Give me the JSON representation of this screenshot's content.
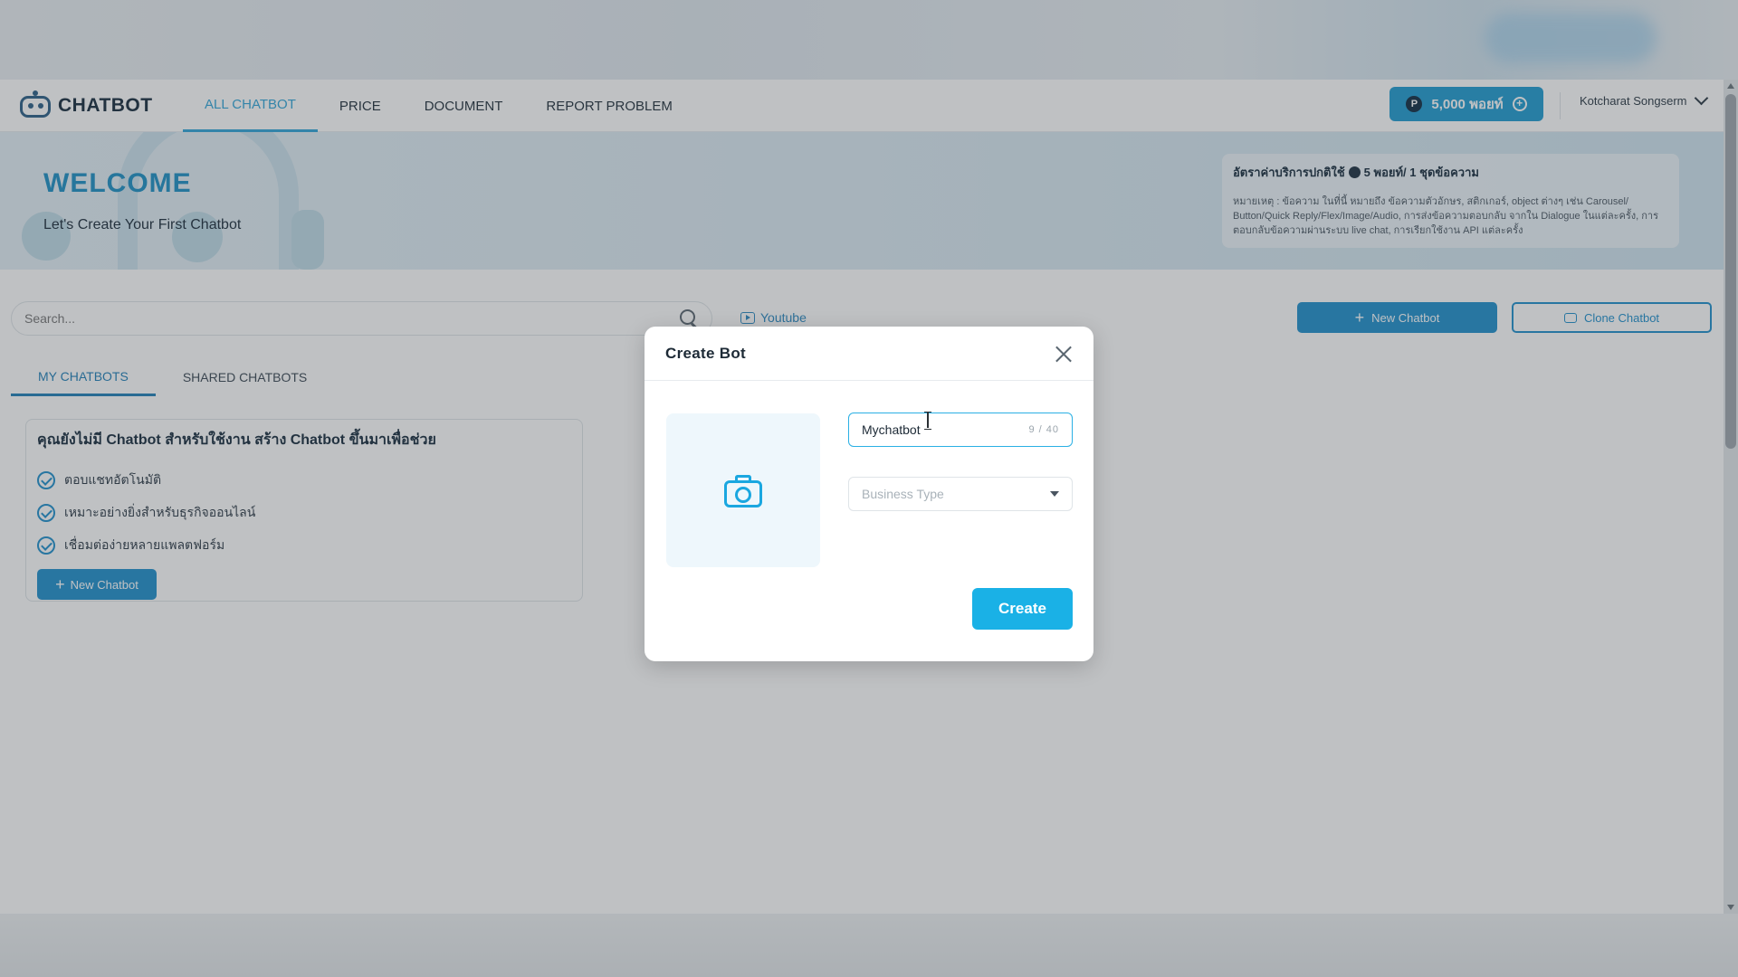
{
  "navbar": {
    "logo_text": "CHATBOT",
    "links": [
      "ALL CHATBOT",
      "PRICE",
      "DOCUMENT",
      "REPORT PROBLEM"
    ],
    "active_link": "ALL CHATBOT",
    "points_label": "5,000 พอยท์",
    "user_name": "Kotcharat Songserm"
  },
  "banner": {
    "welcome": "WELCOME",
    "subtitle": "Let's Create Your First Chatbot",
    "rate_title": "อัตราค่าบริการปกติใช้",
    "rate_value": "5 พอยท์/ 1 ชุดข้อความ",
    "rate_note": "หมายเหตุ : ข้อความ ในที่นี้ หมายถึง ข้อความตัวอักษร, สติกเกอร์, object ต่างๆ เช่น Carousel/ Button/Quick Reply/Flex/Image/Audio, การส่งข้อความตอบกลับ จากใน Dialogue ในแต่ละครั้ง, การตอบกลับข้อความผ่านระบบ live chat, การเรียกใช้งาน API แต่ละครั้ง"
  },
  "toolbar": {
    "search_placeholder": "Search...",
    "youtube_label": "Youtube",
    "new_chatbot_label": "New Chatbot",
    "clone_chatbot_label": "Clone Chatbot"
  },
  "tabs": [
    "MY CHATBOTS",
    "SHARED CHATBOTS"
  ],
  "active_tab": "MY CHATBOTS",
  "empty_card": {
    "title": "คุณยังไม่มี Chatbot สำหรับใช้งาน สร้าง Chatbot ขึ้นมาเพื่อช่วย",
    "features": [
      "ตอบแชทอัตโนมัติ",
      "เหมาะอย่างยิ่งสำหรับธุรกิจออนไลน์",
      "เชื่อมต่อง่ายหลายแพลตฟอร์ม"
    ],
    "button_label": "New Chatbot"
  },
  "modal": {
    "title": "Create Bot",
    "name_value": "Mychatbot",
    "name_counter": "9 / 40",
    "business_type_placeholder": "Business Type",
    "create_label": "Create"
  },
  "colors": {
    "primary": "#1f8fcd",
    "accent": "#1ab1e6",
    "welcome": "#1c8fc5",
    "nav_active": "#2fa5d8"
  }
}
